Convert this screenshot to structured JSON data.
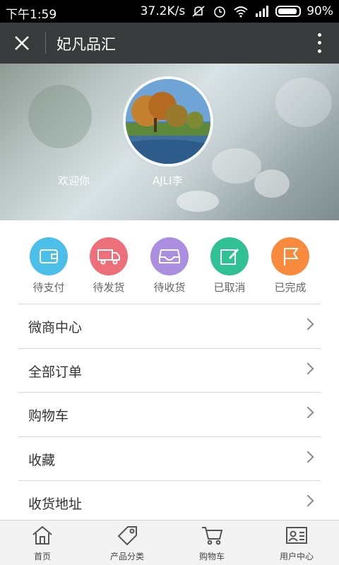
{
  "status_bar": {
    "time": "下午1:59",
    "net_speed": "37.2K/s",
    "battery": "90%",
    "icons": [
      "mute-vibrate-icon",
      "alarm-icon",
      "wifi-icon",
      "signal-icon",
      "battery-icon"
    ]
  },
  "title_bar": {
    "title": "妃凡品汇",
    "close_icon": "close-icon",
    "more_icon": "more-vertical-icon"
  },
  "profile": {
    "welcome": "欢迎你",
    "username": "AJLI李",
    "avatar": "landscape-tree-lake-photo"
  },
  "order_status": [
    {
      "label": "待支付",
      "icon": "wallet-icon",
      "color": "#4bbfe8"
    },
    {
      "label": "待发货",
      "icon": "truck-icon",
      "color": "#ec6f7a"
    },
    {
      "label": "待收货",
      "icon": "inbox-tray-icon",
      "color": "#ab8ee0"
    },
    {
      "label": "已取消",
      "icon": "edit-note-icon",
      "color": "#2fc194"
    },
    {
      "label": "已完成",
      "icon": "flag-icon",
      "color": "#f78a3d"
    }
  ],
  "menu": [
    {
      "label": "微商中心"
    },
    {
      "label": "全部订单"
    },
    {
      "label": "购物车"
    },
    {
      "label": "收藏"
    },
    {
      "label": "收货地址"
    }
  ],
  "bottom_nav": [
    {
      "label": "首页",
      "icon": "home-icon"
    },
    {
      "label": "产品分类",
      "icon": "tag-icon"
    },
    {
      "label": "购物车",
      "icon": "cart-icon"
    },
    {
      "label": "用户中心",
      "icon": "user-card-icon"
    }
  ]
}
